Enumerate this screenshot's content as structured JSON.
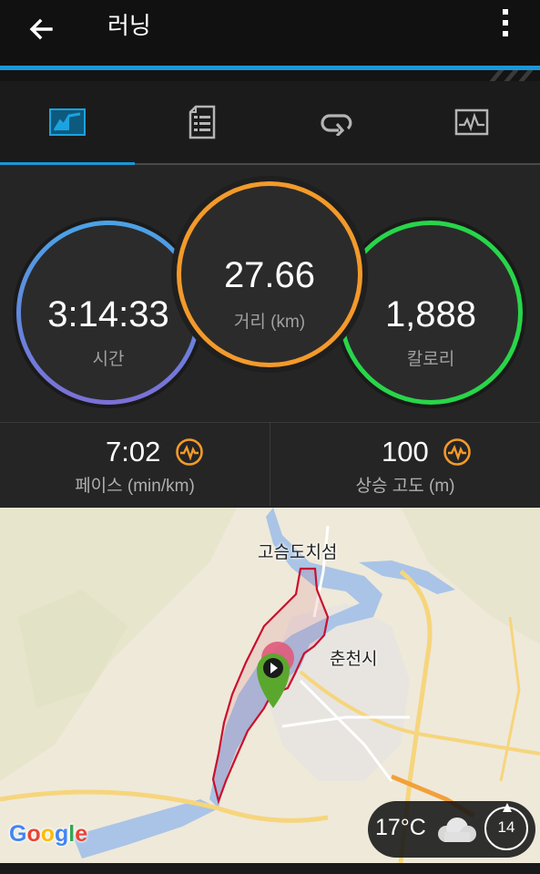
{
  "app": {
    "title": "러닝"
  },
  "tabs": [
    {
      "icon": "summary-chart-icon",
      "selected": true
    },
    {
      "icon": "details-list-icon",
      "selected": false
    },
    {
      "icon": "laps-loop-icon",
      "selected": false
    },
    {
      "icon": "graph-pulse-icon",
      "selected": false
    }
  ],
  "stats": {
    "time": {
      "value": "3:14:33",
      "label": "시간"
    },
    "distance": {
      "value": "27.66",
      "label": "거리 (km)"
    },
    "calories": {
      "value": "1,888",
      "label": "칼로리"
    }
  },
  "metrics": {
    "pace": {
      "value": "7:02",
      "label": "페이스 (min/km)",
      "icon": "insight-pulse-icon"
    },
    "elevation": {
      "value": "100",
      "label": "상승 고도 (m)",
      "icon": "insight-pulse-icon"
    }
  },
  "map": {
    "places": [
      "고슴도치섬",
      "춘천시"
    ],
    "attribution": "Google",
    "weather": {
      "temperature": "17°C",
      "icon": "cloudy-icon",
      "wind": "14"
    }
  },
  "colors": {
    "accent": "#1a98d6",
    "time_ring": "#5aa0e0",
    "distance_ring": "#f39a2a",
    "calories_ring": "#27d649",
    "route": "#c8102e"
  }
}
